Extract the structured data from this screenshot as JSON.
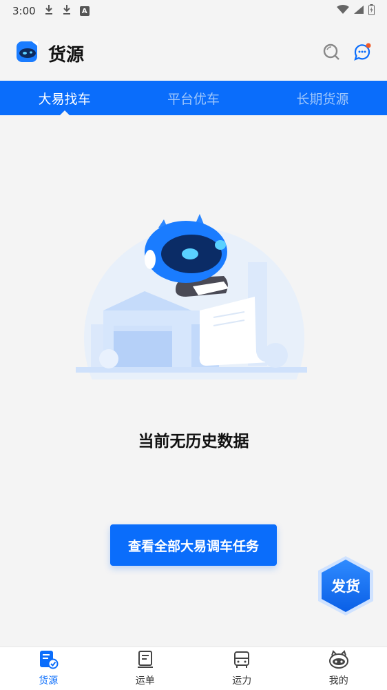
{
  "status_bar": {
    "time": "3:00",
    "badge": "A"
  },
  "header": {
    "title": "货源"
  },
  "tabs": [
    {
      "label": "大易找车",
      "active": true
    },
    {
      "label": "平台优车",
      "active": false
    },
    {
      "label": "长期货源",
      "active": false
    }
  ],
  "empty_state": {
    "message": "当前无历史数据"
  },
  "cta": {
    "label": "查看全部大易调车任务"
  },
  "fab": {
    "label": "发货"
  },
  "bottom_nav": [
    {
      "label": "货源",
      "icon": "cargo-icon",
      "active": true
    },
    {
      "label": "运单",
      "icon": "waybill-icon",
      "active": false
    },
    {
      "label": "运力",
      "icon": "truck-icon",
      "active": false
    },
    {
      "label": "我的",
      "icon": "profile-icon",
      "active": false
    }
  ],
  "colors": {
    "primary": "#0a6dfb",
    "background": "#f4f4f4",
    "notification_dot": "#f05a28"
  }
}
